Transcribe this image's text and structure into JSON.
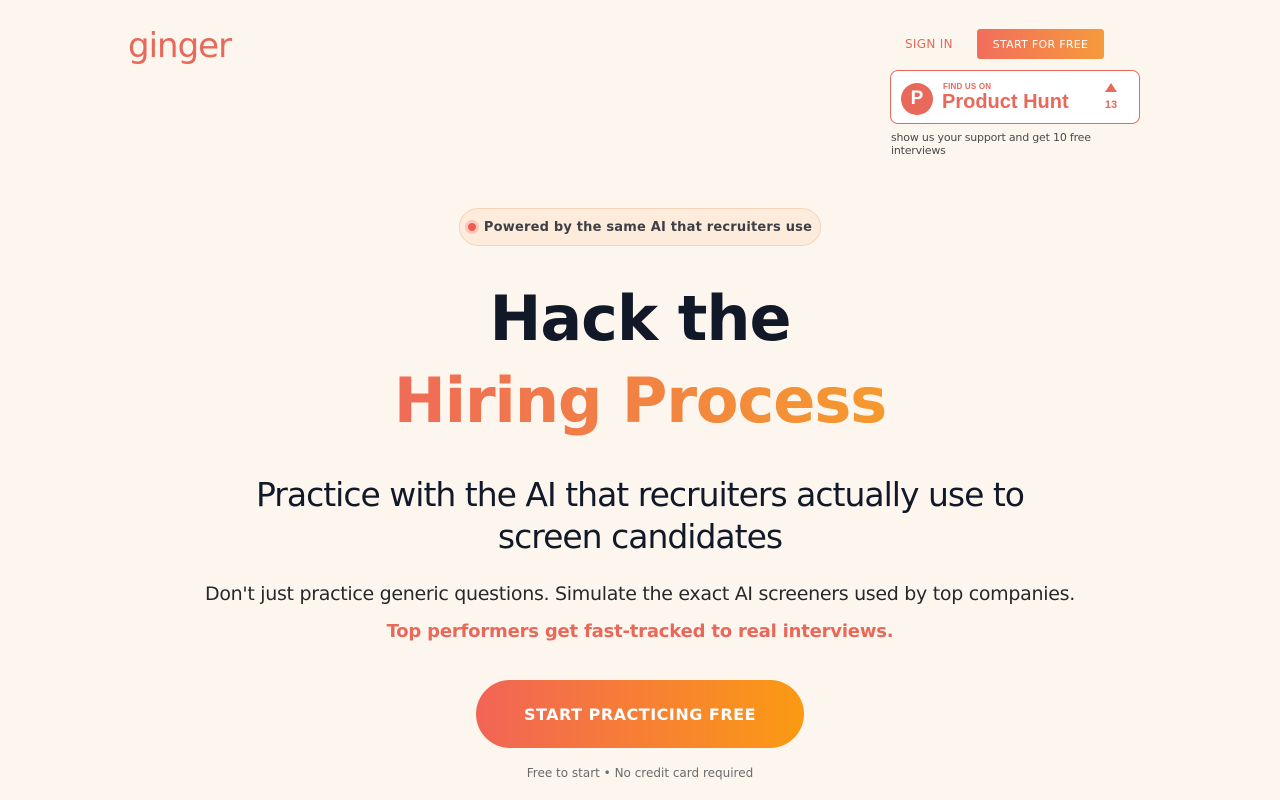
{
  "header": {
    "logo": "ginger",
    "sign_in": "SIGN IN",
    "start_for_free": "START FOR FREE"
  },
  "product_hunt": {
    "logo_letter": "P",
    "find_us": "FIND US ON",
    "name": "Product Hunt",
    "upvotes": "13",
    "caption": "show us your support and get 10 free interviews"
  },
  "hero": {
    "pill": "Powered by the same AI that recruiters use",
    "headline_line1": "Hack the",
    "headline_line2": "Hiring Process",
    "subtitle": "Practice with the AI that recruiters actually use to screen candidates",
    "description": "Don't just practice generic questions. Simulate the exact AI screeners used by top companies.",
    "highlight": "Top performers get fast-tracked to real interviews.",
    "cta": "START PRACTICING FREE",
    "fineprint": "Free to start • No credit card required"
  },
  "colors": {
    "background": "#fdf6ef",
    "brand": "#e8685a",
    "gradient_start": "#f26456",
    "gradient_end": "#fb9a13",
    "headline": "#111827"
  },
  "icons": {
    "product_hunt": "product-hunt-logo-icon",
    "upvote": "upvote-triangle-icon",
    "status_dot": "status-dot-icon"
  }
}
